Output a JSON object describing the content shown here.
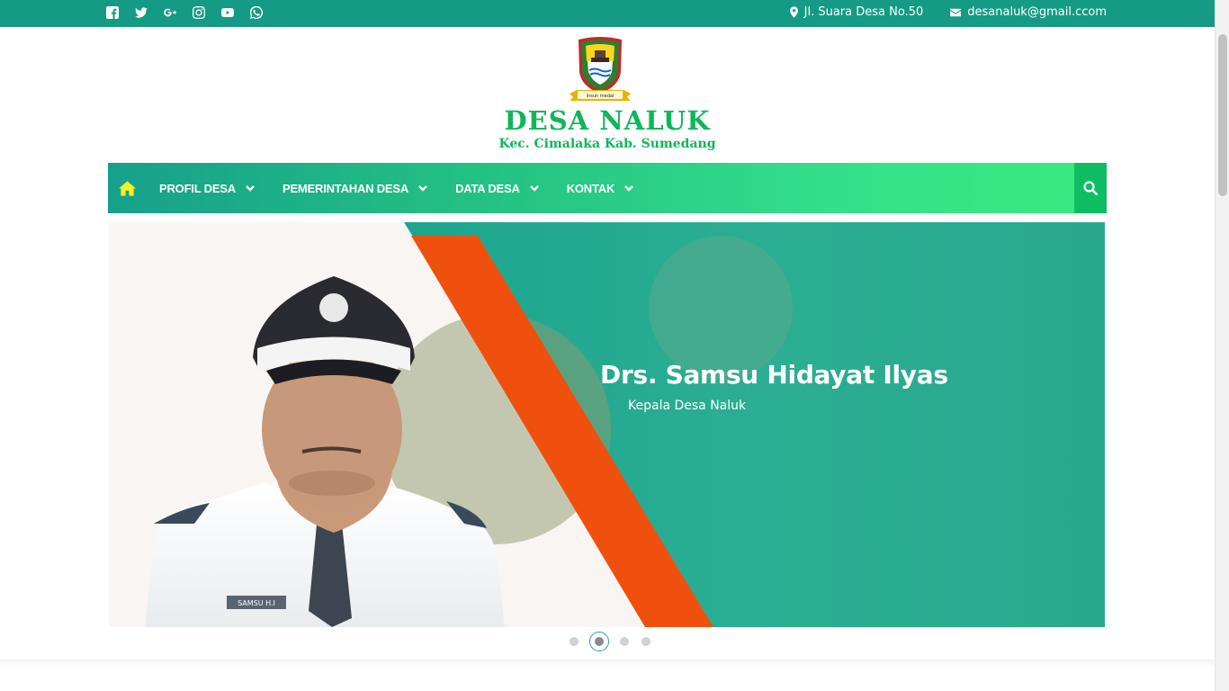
{
  "topbar": {
    "social_icons": [
      "facebook-icon",
      "twitter-icon",
      "google-plus-icon",
      "instagram-icon",
      "youtube-icon",
      "whatsapp-icon"
    ],
    "address": "Jl. Suara Desa No.50",
    "email": "desanaluk@gmail.ccom",
    "background": "#159a85"
  },
  "header": {
    "title": "DESA NALUK",
    "subtitle": "Kec. Cimalaka Kab. Sumedang",
    "logo_ribbon_text": "insun medal",
    "title_color": "#10b65a"
  },
  "nav": {
    "home_icon": "home-icon",
    "items": [
      {
        "label": "PROFIL DESA"
      },
      {
        "label": "PEMERINTAHAN DESA"
      },
      {
        "label": "DATA DESA"
      },
      {
        "label": "KONTAK"
      }
    ],
    "search_icon": "search-icon"
  },
  "slider": {
    "title": "Drs. Samsu Hidayat Ilyas",
    "subtitle": "Kepala Desa Naluk",
    "name_tag": "SAMSU H.I",
    "slide_count": 4,
    "active_slide": 2
  }
}
